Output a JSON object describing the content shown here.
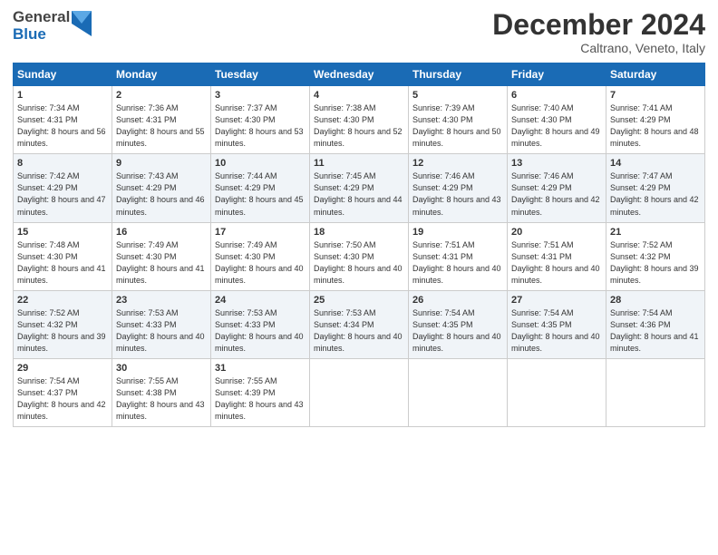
{
  "header": {
    "logo_general": "General",
    "logo_blue": "Blue",
    "title": "December 2024",
    "subtitle": "Caltrano, Veneto, Italy"
  },
  "days_of_week": [
    "Sunday",
    "Monday",
    "Tuesday",
    "Wednesday",
    "Thursday",
    "Friday",
    "Saturday"
  ],
  "weeks": [
    [
      {
        "day": "1",
        "sunrise": "Sunrise: 7:34 AM",
        "sunset": "Sunset: 4:31 PM",
        "daylight": "Daylight: 8 hours and 56 minutes."
      },
      {
        "day": "2",
        "sunrise": "Sunrise: 7:36 AM",
        "sunset": "Sunset: 4:31 PM",
        "daylight": "Daylight: 8 hours and 55 minutes."
      },
      {
        "day": "3",
        "sunrise": "Sunrise: 7:37 AM",
        "sunset": "Sunset: 4:30 PM",
        "daylight": "Daylight: 8 hours and 53 minutes."
      },
      {
        "day": "4",
        "sunrise": "Sunrise: 7:38 AM",
        "sunset": "Sunset: 4:30 PM",
        "daylight": "Daylight: 8 hours and 52 minutes."
      },
      {
        "day": "5",
        "sunrise": "Sunrise: 7:39 AM",
        "sunset": "Sunset: 4:30 PM",
        "daylight": "Daylight: 8 hours and 50 minutes."
      },
      {
        "day": "6",
        "sunrise": "Sunrise: 7:40 AM",
        "sunset": "Sunset: 4:30 PM",
        "daylight": "Daylight: 8 hours and 49 minutes."
      },
      {
        "day": "7",
        "sunrise": "Sunrise: 7:41 AM",
        "sunset": "Sunset: 4:29 PM",
        "daylight": "Daylight: 8 hours and 48 minutes."
      }
    ],
    [
      {
        "day": "8",
        "sunrise": "Sunrise: 7:42 AM",
        "sunset": "Sunset: 4:29 PM",
        "daylight": "Daylight: 8 hours and 47 minutes."
      },
      {
        "day": "9",
        "sunrise": "Sunrise: 7:43 AM",
        "sunset": "Sunset: 4:29 PM",
        "daylight": "Daylight: 8 hours and 46 minutes."
      },
      {
        "day": "10",
        "sunrise": "Sunrise: 7:44 AM",
        "sunset": "Sunset: 4:29 PM",
        "daylight": "Daylight: 8 hours and 45 minutes."
      },
      {
        "day": "11",
        "sunrise": "Sunrise: 7:45 AM",
        "sunset": "Sunset: 4:29 PM",
        "daylight": "Daylight: 8 hours and 44 minutes."
      },
      {
        "day": "12",
        "sunrise": "Sunrise: 7:46 AM",
        "sunset": "Sunset: 4:29 PM",
        "daylight": "Daylight: 8 hours and 43 minutes."
      },
      {
        "day": "13",
        "sunrise": "Sunrise: 7:46 AM",
        "sunset": "Sunset: 4:29 PM",
        "daylight": "Daylight: 8 hours and 42 minutes."
      },
      {
        "day": "14",
        "sunrise": "Sunrise: 7:47 AM",
        "sunset": "Sunset: 4:29 PM",
        "daylight": "Daylight: 8 hours and 42 minutes."
      }
    ],
    [
      {
        "day": "15",
        "sunrise": "Sunrise: 7:48 AM",
        "sunset": "Sunset: 4:30 PM",
        "daylight": "Daylight: 8 hours and 41 minutes."
      },
      {
        "day": "16",
        "sunrise": "Sunrise: 7:49 AM",
        "sunset": "Sunset: 4:30 PM",
        "daylight": "Daylight: 8 hours and 41 minutes."
      },
      {
        "day": "17",
        "sunrise": "Sunrise: 7:49 AM",
        "sunset": "Sunset: 4:30 PM",
        "daylight": "Daylight: 8 hours and 40 minutes."
      },
      {
        "day": "18",
        "sunrise": "Sunrise: 7:50 AM",
        "sunset": "Sunset: 4:30 PM",
        "daylight": "Daylight: 8 hours and 40 minutes."
      },
      {
        "day": "19",
        "sunrise": "Sunrise: 7:51 AM",
        "sunset": "Sunset: 4:31 PM",
        "daylight": "Daylight: 8 hours and 40 minutes."
      },
      {
        "day": "20",
        "sunrise": "Sunrise: 7:51 AM",
        "sunset": "Sunset: 4:31 PM",
        "daylight": "Daylight: 8 hours and 40 minutes."
      },
      {
        "day": "21",
        "sunrise": "Sunrise: 7:52 AM",
        "sunset": "Sunset: 4:32 PM",
        "daylight": "Daylight: 8 hours and 39 minutes."
      }
    ],
    [
      {
        "day": "22",
        "sunrise": "Sunrise: 7:52 AM",
        "sunset": "Sunset: 4:32 PM",
        "daylight": "Daylight: 8 hours and 39 minutes."
      },
      {
        "day": "23",
        "sunrise": "Sunrise: 7:53 AM",
        "sunset": "Sunset: 4:33 PM",
        "daylight": "Daylight: 8 hours and 40 minutes."
      },
      {
        "day": "24",
        "sunrise": "Sunrise: 7:53 AM",
        "sunset": "Sunset: 4:33 PM",
        "daylight": "Daylight: 8 hours and 40 minutes."
      },
      {
        "day": "25",
        "sunrise": "Sunrise: 7:53 AM",
        "sunset": "Sunset: 4:34 PM",
        "daylight": "Daylight: 8 hours and 40 minutes."
      },
      {
        "day": "26",
        "sunrise": "Sunrise: 7:54 AM",
        "sunset": "Sunset: 4:35 PM",
        "daylight": "Daylight: 8 hours and 40 minutes."
      },
      {
        "day": "27",
        "sunrise": "Sunrise: 7:54 AM",
        "sunset": "Sunset: 4:35 PM",
        "daylight": "Daylight: 8 hours and 40 minutes."
      },
      {
        "day": "28",
        "sunrise": "Sunrise: 7:54 AM",
        "sunset": "Sunset: 4:36 PM",
        "daylight": "Daylight: 8 hours and 41 minutes."
      }
    ],
    [
      {
        "day": "29",
        "sunrise": "Sunrise: 7:54 AM",
        "sunset": "Sunset: 4:37 PM",
        "daylight": "Daylight: 8 hours and 42 minutes."
      },
      {
        "day": "30",
        "sunrise": "Sunrise: 7:55 AM",
        "sunset": "Sunset: 4:38 PM",
        "daylight": "Daylight: 8 hours and 43 minutes."
      },
      {
        "day": "31",
        "sunrise": "Sunrise: 7:55 AM",
        "sunset": "Sunset: 4:39 PM",
        "daylight": "Daylight: 8 hours and 43 minutes."
      },
      null,
      null,
      null,
      null
    ]
  ]
}
